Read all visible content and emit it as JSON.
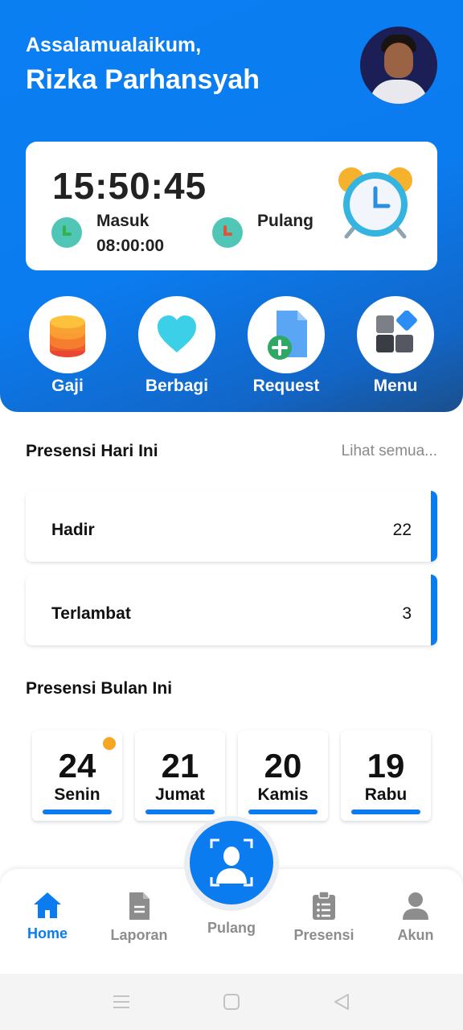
{
  "header": {
    "greeting": "Assalamualaikum,",
    "user_name": "Rizka Parhansyah"
  },
  "clock_card": {
    "time": "15:50:45",
    "check_in_label": "Masuk",
    "check_in_time": "08:00:00",
    "check_out_label": "Pulang",
    "check_out_time": ""
  },
  "quick_actions": [
    {
      "label": "Gaji",
      "icon": "coins-icon"
    },
    {
      "label": "Berbagi",
      "icon": "heart-icon"
    },
    {
      "label": "Request",
      "icon": "add-document-icon"
    },
    {
      "label": "Menu",
      "icon": "widgets-icon"
    }
  ],
  "today": {
    "title": "Presensi Hari Ini",
    "see_all": "Lihat semua...",
    "stats": [
      {
        "label": "Hadir",
        "value": "22"
      },
      {
        "label": "Terlambat",
        "value": "3"
      }
    ]
  },
  "month": {
    "title": "Presensi Bulan Ini",
    "days": [
      {
        "num": "24",
        "name": "Senin"
      },
      {
        "num": "21",
        "name": "Jumat"
      },
      {
        "num": "20",
        "name": "Kamis"
      },
      {
        "num": "19",
        "name": "Rabu"
      }
    ]
  },
  "bottom_nav": {
    "items": [
      {
        "label": "Home",
        "icon": "home-icon",
        "active": true
      },
      {
        "label": "Laporan",
        "icon": "document-icon"
      },
      {
        "label": "Pulang",
        "icon": "face-scan-icon"
      },
      {
        "label": "Presensi",
        "icon": "clipboard-list-icon"
      },
      {
        "label": "Akun",
        "icon": "user-icon"
      }
    ]
  },
  "colors": {
    "primary": "#0b7cf0",
    "accent_dot": "#f5a623",
    "clock_icon": "#4fc6b6"
  }
}
